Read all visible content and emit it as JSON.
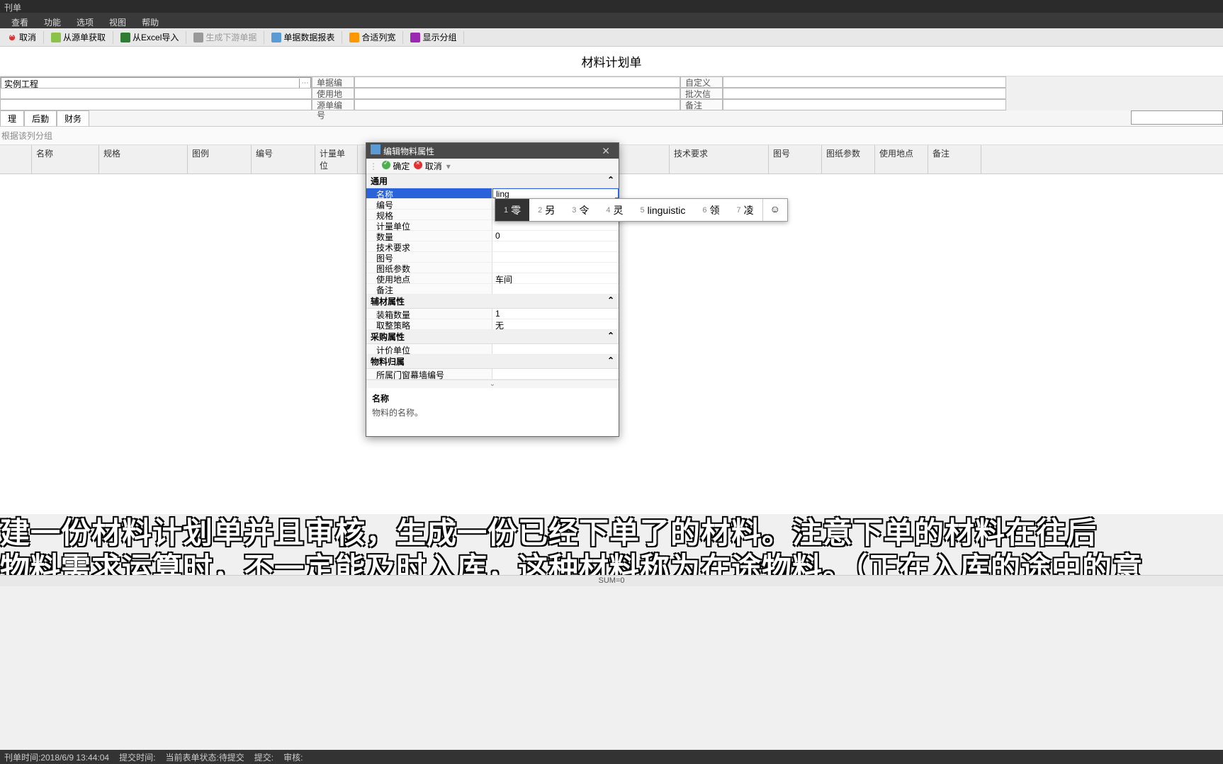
{
  "window_title": "刊单",
  "menubar": [
    "查看",
    "功能",
    "选项",
    "视图",
    "帮助"
  ],
  "toolbar": [
    {
      "id": "cancel",
      "label": "取消",
      "icon": "cancel"
    },
    {
      "id": "fromsrc",
      "label": "从源单获取",
      "icon": "src"
    },
    {
      "id": "excel",
      "label": "从Excel导入",
      "icon": "excel"
    },
    {
      "id": "gen",
      "label": "生成下游单据",
      "icon": "gen",
      "disabled": true
    },
    {
      "id": "report",
      "label": "单据数据报表",
      "icon": "report"
    },
    {
      "id": "width",
      "label": "合适列宽",
      "icon": "width"
    },
    {
      "id": "group",
      "label": "显示分组",
      "icon": "group"
    }
  ],
  "doc_title": "材料计划单",
  "project_value": "实例工程",
  "header_fields": {
    "r1": [
      {
        "k": "单据编码",
        "v": ""
      },
      {
        "k": "自定义单号",
        "v": ""
      }
    ],
    "r2": [
      {
        "k": "使用地点",
        "v": ""
      },
      {
        "k": "批次信息",
        "v": ""
      }
    ],
    "r3": [
      {
        "k": "源单编号",
        "v": ""
      },
      {
        "k": "备注",
        "v": ""
      }
    ]
  },
  "tabs": [
    "理",
    "后勤",
    "财务"
  ],
  "group_hint": "根据该列分组",
  "grid_cols": [
    "",
    "名称",
    "规格",
    "图例",
    "编号",
    "计量单位",
    "",
    "技术要求",
    "图号",
    "图纸参数",
    "使用地点",
    "备注"
  ],
  "grid_col_widths": [
    45,
    95,
    125,
    90,
    90,
    60,
    440,
    140,
    75,
    75,
    75,
    75
  ],
  "dialog": {
    "title": "编辑物料属性",
    "ok": "确定",
    "cancel": "取消",
    "input_value": "ling",
    "sections": [
      {
        "name": "通用",
        "rows": [
          {
            "k": "名称",
            "v": "ling",
            "selected": true,
            "input": true
          },
          {
            "k": "编号",
            "v": ""
          },
          {
            "k": "规格",
            "v": ""
          },
          {
            "k": "计量单位",
            "v": ""
          },
          {
            "k": "数量",
            "v": "0"
          },
          {
            "k": "技术要求",
            "v": ""
          },
          {
            "k": "图号",
            "v": ""
          },
          {
            "k": "图纸参数",
            "v": ""
          },
          {
            "k": "使用地点",
            "v": "车间"
          },
          {
            "k": "备注",
            "v": ""
          }
        ]
      },
      {
        "name": "辅材属性",
        "rows": [
          {
            "k": "装箱数量",
            "v": "1"
          },
          {
            "k": "取整策略",
            "v": "无"
          }
        ]
      },
      {
        "name": "采购属性",
        "rows": [
          {
            "k": "计价单位",
            "v": ""
          }
        ]
      },
      {
        "name": "物料归属",
        "rows": [
          {
            "k": "所属门窗幕墙编号",
            "v": ""
          }
        ]
      }
    ],
    "desc_title": "名称",
    "desc_text": "物料的名称。"
  },
  "ime": {
    "candidates": [
      {
        "n": "1",
        "t": "零",
        "sel": true
      },
      {
        "n": "2",
        "t": "另"
      },
      {
        "n": "3",
        "t": "令"
      },
      {
        "n": "4",
        "t": "灵"
      },
      {
        "n": "5",
        "t": "linguistic"
      },
      {
        "n": "6",
        "t": "领"
      },
      {
        "n": "7",
        "t": "凌"
      }
    ]
  },
  "subtitle_l1": "建一份材料计划单并且审核，生成一份已经下单了的材料。注意下单的材料在往后",
  "subtitle_l2": "物料需求运算时，不一定能及时入库，这种材料称为在途物料。（正在入库的途中的意",
  "sum_text": "SUM=0",
  "status": {
    "time": "刊单时间:2018/6/9 13:44:04",
    "submit": "提交时间:",
    "state": "当前表单状态:待提交",
    "submitter": "提交:",
    "reviewer": "审核:"
  }
}
